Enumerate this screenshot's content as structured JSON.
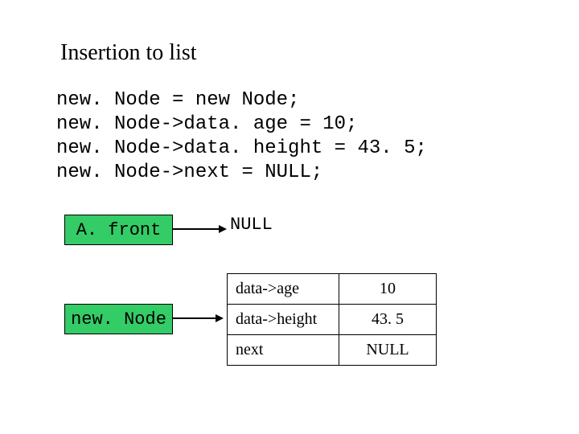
{
  "title": "Insertion to list",
  "code": {
    "l1": "new. Node = new Node;",
    "l2": "new. Node->data. age = 10;",
    "l3": "new. Node->data. height = 43. 5;",
    "l4": "new. Node->next = NULL;"
  },
  "diagram": {
    "afront_label": "A. front",
    "null_label": "NULL",
    "newnode_label": "new. Node",
    "table": {
      "r1k": "data->age",
      "r1v": "10",
      "r2k": "data->height",
      "r2v": "43. 5",
      "r3k": "next",
      "r3v": "NULL"
    }
  }
}
